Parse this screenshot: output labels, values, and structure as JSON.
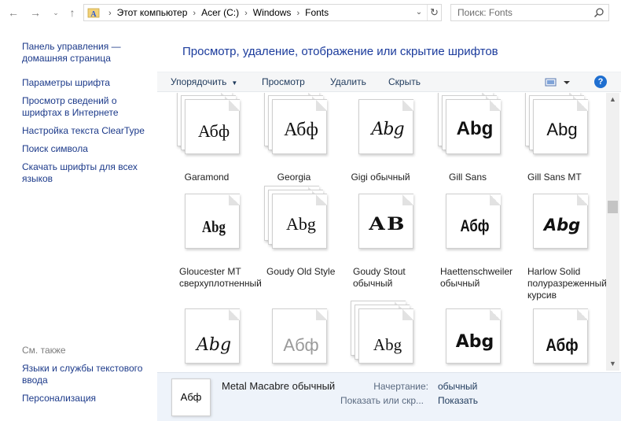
{
  "address_bar": {
    "crumbs": [
      "Этот компьютер",
      "Acer (C:)",
      "Windows",
      "Fonts"
    ],
    "search_placeholder": "Поиск: Fonts"
  },
  "sidebar": {
    "home_link": "Панель управления — домашняя страница",
    "links": [
      "Параметры шрифта",
      "Просмотр сведений о шрифтах в Интернете",
      "Настройка текста ClearType",
      "Поиск символа",
      "Скачать шрифты для всех языков"
    ],
    "see_also_heading": "См. также",
    "see_also": [
      "Языки и службы текстового ввода",
      "Персонализация"
    ]
  },
  "main": {
    "title": "Просмотр, удаление, отображение или скрытие шрифтов"
  },
  "toolbar": {
    "organize": "Упорядочить",
    "preview": "Просмотр",
    "delete": "Удалить",
    "hide": "Скрыть",
    "help": "?"
  },
  "fonts": [
    {
      "name": "Garamond",
      "sample": "Абф",
      "stack": true,
      "dim": false
    },
    {
      "name": "Georgia",
      "sample": "Абф",
      "stack": true,
      "dim": false
    },
    {
      "name": "Gigi обычный",
      "sample": "Abg",
      "stack": false,
      "dim": false
    },
    {
      "name": "Gill Sans",
      "sample": "Abg",
      "stack": true,
      "dim": false
    },
    {
      "name": "Gill Sans MT",
      "sample": "Abg",
      "stack": true,
      "dim": false
    },
    {
      "name": "Gloucester MT сверхуплотненный",
      "sample": "Abg",
      "stack": false,
      "dim": false
    },
    {
      "name": "Goudy Old Style",
      "sample": "Abg",
      "stack": true,
      "dim": false
    },
    {
      "name": "Goudy Stout обычный",
      "sample": "AB",
      "stack": false,
      "dim": false
    },
    {
      "name": "Haettenschweiler обычный",
      "sample": "Абф",
      "stack": false,
      "dim": false
    },
    {
      "name": "Harlow Solid полуразреженный курсив",
      "sample": "Abg",
      "stack": false,
      "dim": false
    },
    {
      "name": "",
      "sample": "Abg",
      "stack": false,
      "dim": false
    },
    {
      "name": "",
      "sample": "Абф",
      "stack": false,
      "dim": true
    },
    {
      "name": "",
      "sample": "Abg",
      "stack": true,
      "dim": false
    },
    {
      "name": "",
      "sample": "Abg",
      "stack": false,
      "dim": false
    },
    {
      "name": "",
      "sample": "Абф",
      "stack": false,
      "dim": false
    }
  ],
  "details": {
    "thumb_sample": "Абф",
    "font_name": "Metal Macabre обычный",
    "style_label": "Начертание:",
    "style_value": "обычный",
    "show_hide_label": "Показать или скр...",
    "show_hide_value": "Показать"
  },
  "colors": {
    "link": "#1c3a8a",
    "title": "#1b3b9c",
    "details_bg": "#eef3fa"
  }
}
